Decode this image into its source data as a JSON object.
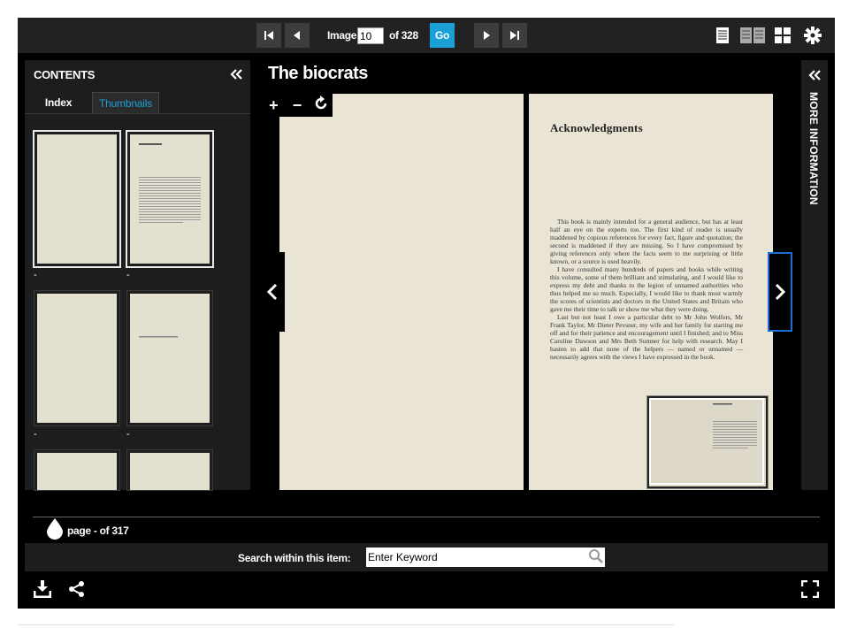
{
  "toolbar": {
    "image_label": "Image",
    "image_value": "10",
    "of_label": "of 328",
    "go_label": "Go"
  },
  "contents": {
    "title": "CONTENTS",
    "tabs": [
      "Index",
      "Thumbnails"
    ],
    "thumb_dashes": [
      "-",
      "-",
      "-",
      "-"
    ]
  },
  "main": {
    "title": "The biocrats",
    "zoom": {
      "plus": "+",
      "minus": "−"
    },
    "page_heading": "Acknowledgments",
    "page_paragraphs": [
      "This book is mainly intended for a general audience, but has at least half an eye on the experts too. The first kind of reader is usually maddened by copious references for every fact, figure and quotation; the second is maddened if they are missing. So I have compromised by giving references only where the facts seem to me surprising or little known, or a source is used heavily.",
      "I have consulted many hundreds of papers and books while writing this volume, some of them brilliant and stimulating, and I would like to express my debt and thanks to the legion of unnamed authorities who thus helped me so much. Especially, I would like to thank most warmly the scores of scientists and doctors in the United States and Britain who gave me their time to talk or show me what they were doing.",
      "Last but not least I owe a particular debt to Mr John Wolfers, Mr Frank Taylor, Mr Dieter Pevsner, my wife and her family for starting me off and for their patience and encouragement until I finished; and to Miss Caroline Dawson and Mrs Beth Sumner for help with research. May I hasten to add that none of the helpers — named or unnamed — necessarily agrees with the views I have expressed in the book."
    ],
    "more_info": "MORE INFORMATION"
  },
  "footer": {
    "page_info": "page - of 317",
    "search_label": "Search within this item:",
    "search_value": "Enter Keyword"
  },
  "colors": {
    "accent": "#1a9fd6",
    "background": "#000000",
    "panel": "#1d1d1d"
  }
}
